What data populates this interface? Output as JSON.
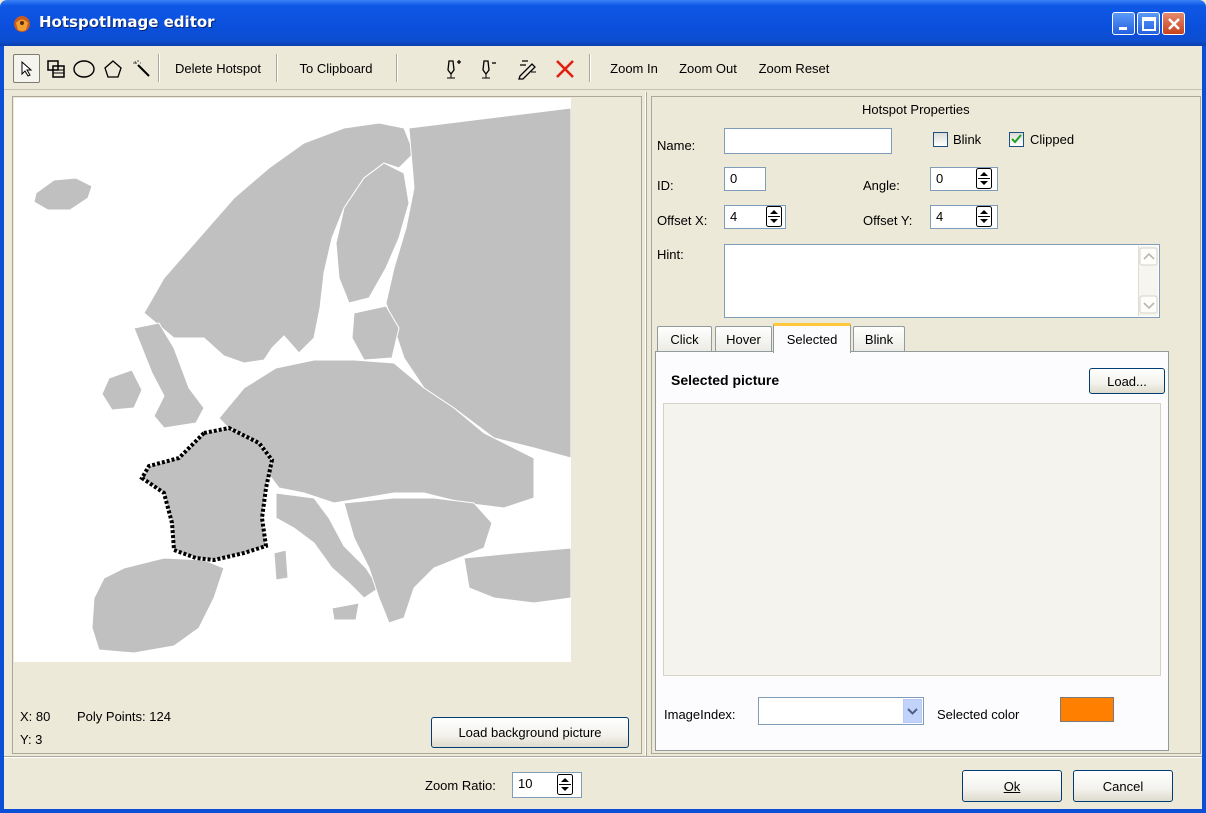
{
  "window": {
    "title": "HotspotImage editor"
  },
  "toolbar": {
    "tools": [
      "pointer-icon",
      "rectangle-icon",
      "ellipse-icon",
      "polygon-icon",
      "magic-wand-icon"
    ],
    "delete_hotspot": "Delete Hotspot",
    "to_clipboard": "To Clipboard",
    "zoom_in": "Zoom In",
    "zoom_out": "Zoom Out",
    "zoom_reset": "Zoom Reset"
  },
  "status": {
    "x": "X: 80",
    "y": "Y: 3",
    "poly_points": "Poly Points: 124"
  },
  "load_background_label": "Load background picture",
  "properties": {
    "heading": "Hotspot Properties",
    "name_label": "Name:",
    "name_value": "",
    "blink_label": "Blink",
    "blink_checked": false,
    "clipped_label": "Clipped",
    "clipped_checked": true,
    "id_label": "ID:",
    "id_value": "0",
    "angle_label": "Angle:",
    "angle_value": "0",
    "offset_x_label": "Offset X:",
    "offset_x_value": "4",
    "offset_y_label": "Offset Y:",
    "offset_y_value": "4",
    "hint_label": "Hint:",
    "hint_value": ""
  },
  "tabs": {
    "items": [
      "Click",
      "Hover",
      "Selected",
      "Blink"
    ],
    "active": "Selected",
    "selected_picture_label": "Selected picture",
    "load_label": "Load...",
    "image_index_label": "ImageIndex:",
    "image_index_value": "",
    "selected_color_label": "Selected color",
    "selected_color": "#ff8000"
  },
  "bottom": {
    "zoom_ratio_label": "Zoom Ratio:",
    "zoom_ratio_value": "10",
    "ok_label": "Ok",
    "cancel_label": "Cancel"
  }
}
